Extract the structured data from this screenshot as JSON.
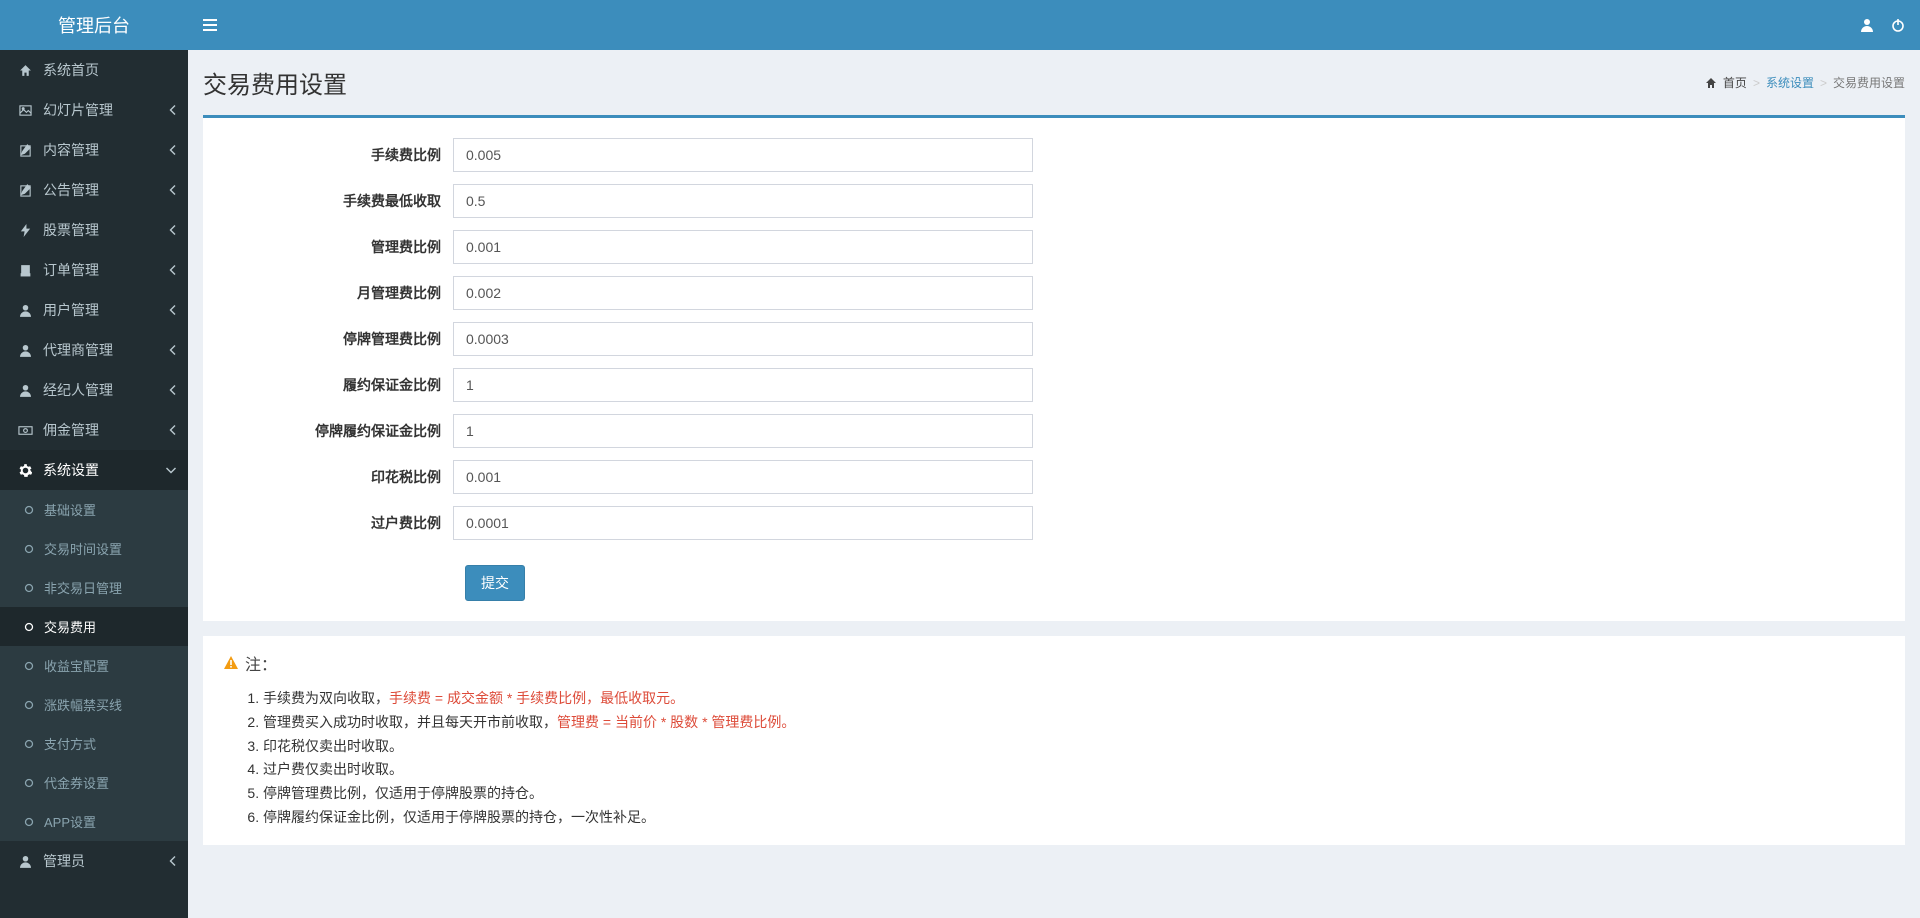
{
  "header": {
    "logo": "管理后台"
  },
  "sidebar": {
    "items": [
      {
        "icon": "home",
        "label": "系统首页",
        "chevron": false
      },
      {
        "icon": "picture",
        "label": "幻灯片管理",
        "chevron": true
      },
      {
        "icon": "edit",
        "label": "内容管理",
        "chevron": true
      },
      {
        "icon": "edit",
        "label": "公告管理",
        "chevron": true
      },
      {
        "icon": "flash",
        "label": "股票管理",
        "chevron": true
      },
      {
        "icon": "book",
        "label": "订单管理",
        "chevron": true
      },
      {
        "icon": "user",
        "label": "用户管理",
        "chevron": true
      },
      {
        "icon": "user",
        "label": "代理商管理",
        "chevron": true
      },
      {
        "icon": "user",
        "label": "经纪人管理",
        "chevron": true
      },
      {
        "icon": "money",
        "label": "佣金管理",
        "chevron": true
      },
      {
        "icon": "gear",
        "label": "系统设置",
        "chevron": true,
        "active": true
      },
      {
        "icon": "user",
        "label": "管理员",
        "chevron": true
      }
    ],
    "submenu": [
      {
        "label": "基础设置"
      },
      {
        "label": "交易时间设置"
      },
      {
        "label": "非交易日管理"
      },
      {
        "label": "交易费用",
        "active": true
      },
      {
        "label": "收益宝配置"
      },
      {
        "label": "涨跌幅禁买线"
      },
      {
        "label": "支付方式"
      },
      {
        "label": "代金券设置"
      },
      {
        "label": "APP设置"
      }
    ]
  },
  "content": {
    "title": "交易费用设置",
    "breadcrumb": {
      "home": "首页",
      "parent": "系统设置",
      "current": "交易费用设置"
    },
    "form": {
      "fields": [
        {
          "label": "手续费比例",
          "value": "0.005"
        },
        {
          "label": "手续费最低收取",
          "value": "0.5"
        },
        {
          "label": "管理费比例",
          "value": "0.001"
        },
        {
          "label": "月管理费比例",
          "value": "0.002"
        },
        {
          "label": "停牌管理费比例",
          "value": "0.0003"
        },
        {
          "label": "履约保证金比例",
          "value": "1"
        },
        {
          "label": "停牌履约保证金比例",
          "value": "1"
        },
        {
          "label": "印花税比例",
          "value": "0.001"
        },
        {
          "label": "过户费比例",
          "value": "0.0001"
        }
      ],
      "submit": "提交"
    },
    "note": {
      "title": "注：",
      "items": [
        {
          "pre": "手续费为双向收取，",
          "red": "手续费 = 成交金额 * 手续费比例，最低收取元。",
          "post": ""
        },
        {
          "pre": "管理费买入成功时收取，并且每天开市前收取，",
          "red": "管理费 = 当前价 * 股数 * 管理费比例。",
          "post": ""
        },
        {
          "pre": "印花税仅卖出时收取。",
          "red": "",
          "post": ""
        },
        {
          "pre": "过户费仅卖出时收取。",
          "red": "",
          "post": ""
        },
        {
          "pre": "停牌管理费比例，仅适用于停牌股票的持仓。",
          "red": "",
          "post": ""
        },
        {
          "pre": "停牌履约保证金比例，仅适用于停牌股票的持仓，一次性补足。",
          "red": "",
          "post": ""
        }
      ]
    }
  }
}
